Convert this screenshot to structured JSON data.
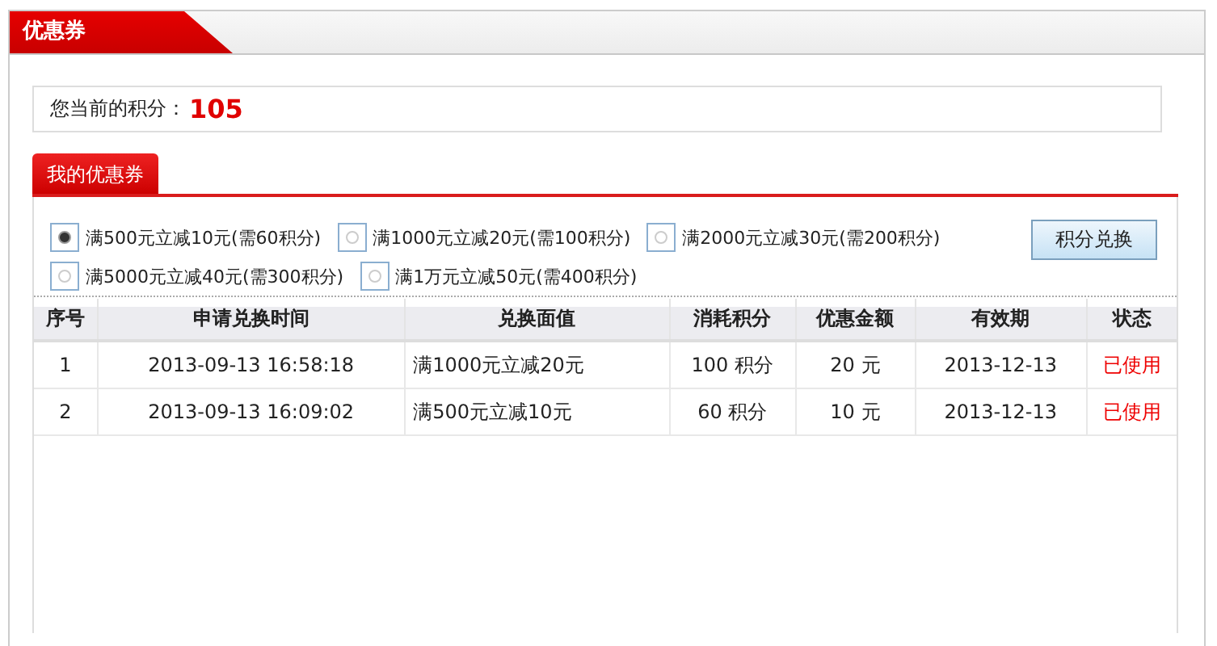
{
  "panel": {
    "title": "优惠券"
  },
  "points": {
    "label": "您当前的积分：",
    "value": "105"
  },
  "tabs": [
    {
      "label": "我的优惠券",
      "selected": true
    }
  ],
  "options": [
    {
      "label": "满500元立减10元(需60积分)",
      "selected": true
    },
    {
      "label": "满1000元立减20元(需100积分)",
      "selected": false
    },
    {
      "label": "满2000元立减30元(需200积分)",
      "selected": false
    },
    {
      "label": "满5000元立减40元(需300积分)",
      "selected": false
    },
    {
      "label": "满1万元立减50元(需400积分)",
      "selected": false
    }
  ],
  "exchange_button": "积分兑换",
  "table": {
    "columns": [
      "序号",
      "申请兑换时间",
      "兑换面值",
      "消耗积分",
      "优惠金额",
      "有效期",
      "状态"
    ],
    "rows": [
      [
        "1",
        "2013-09-13 16:58:18",
        "满1000元立减20元",
        "100 积分",
        "20 元",
        "2013-12-13",
        "已使用"
      ],
      [
        "2",
        "2013-09-13 16:09:02",
        "满500元立减10元",
        "60 积分",
        "10 元",
        "2013-12-13",
        "已使用"
      ]
    ]
  }
}
